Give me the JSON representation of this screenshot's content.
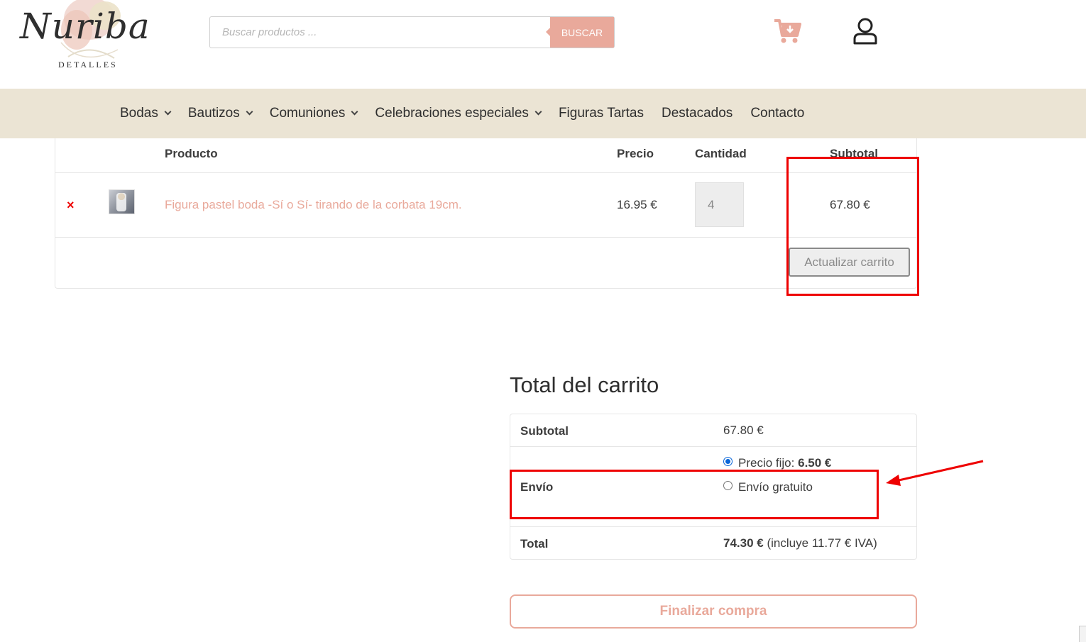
{
  "header": {
    "logo_script": "Nuriba",
    "logo_sub": "DETALLES",
    "search_placeholder": "Buscar productos ...",
    "search_button": "BUSCAR"
  },
  "nav": {
    "items": [
      {
        "label": "Bodas",
        "has_dropdown": true
      },
      {
        "label": "Bautizos",
        "has_dropdown": true
      },
      {
        "label": "Comuniones",
        "has_dropdown": true
      },
      {
        "label": "Celebraciones especiales",
        "has_dropdown": true
      },
      {
        "label": "Figuras Tartas",
        "has_dropdown": false
      },
      {
        "label": "Destacados",
        "has_dropdown": false
      },
      {
        "label": "Contacto",
        "has_dropdown": false
      }
    ]
  },
  "cart": {
    "columns": {
      "product": "Producto",
      "price": "Precio",
      "quantity": "Cantidad",
      "subtotal": "Subtotal"
    },
    "item": {
      "remove": "×",
      "name": "Figura pastel boda -Sí o Sí- tirando de la corbata 19cm.",
      "price": "16.95 €",
      "quantity": "4",
      "subtotal": "67.80 €"
    },
    "update_button": "Actualizar carrito"
  },
  "totals": {
    "title": "Total del carrito",
    "subtotal_label": "Subtotal",
    "subtotal_value": "67.80 €",
    "shipping_label": "Envío",
    "shipping_option1_label": "Precio fijo:",
    "shipping_option1_price": "6.50 €",
    "shipping_option1_selected": true,
    "shipping_option2_label": "Envío gratuito",
    "shipping_option2_selected": false,
    "total_label": "Total",
    "total_value": "74.30 €",
    "total_tax_note": "(incluye 11.77 € IVA)",
    "checkout_button": "Finalizar compra"
  },
  "colors": {
    "accent": "#e9a99b",
    "nav_bg": "#ebe4d4",
    "annotation": "#ee0000",
    "remove": "#ee0000",
    "radio_selected": "#0a66d8"
  }
}
